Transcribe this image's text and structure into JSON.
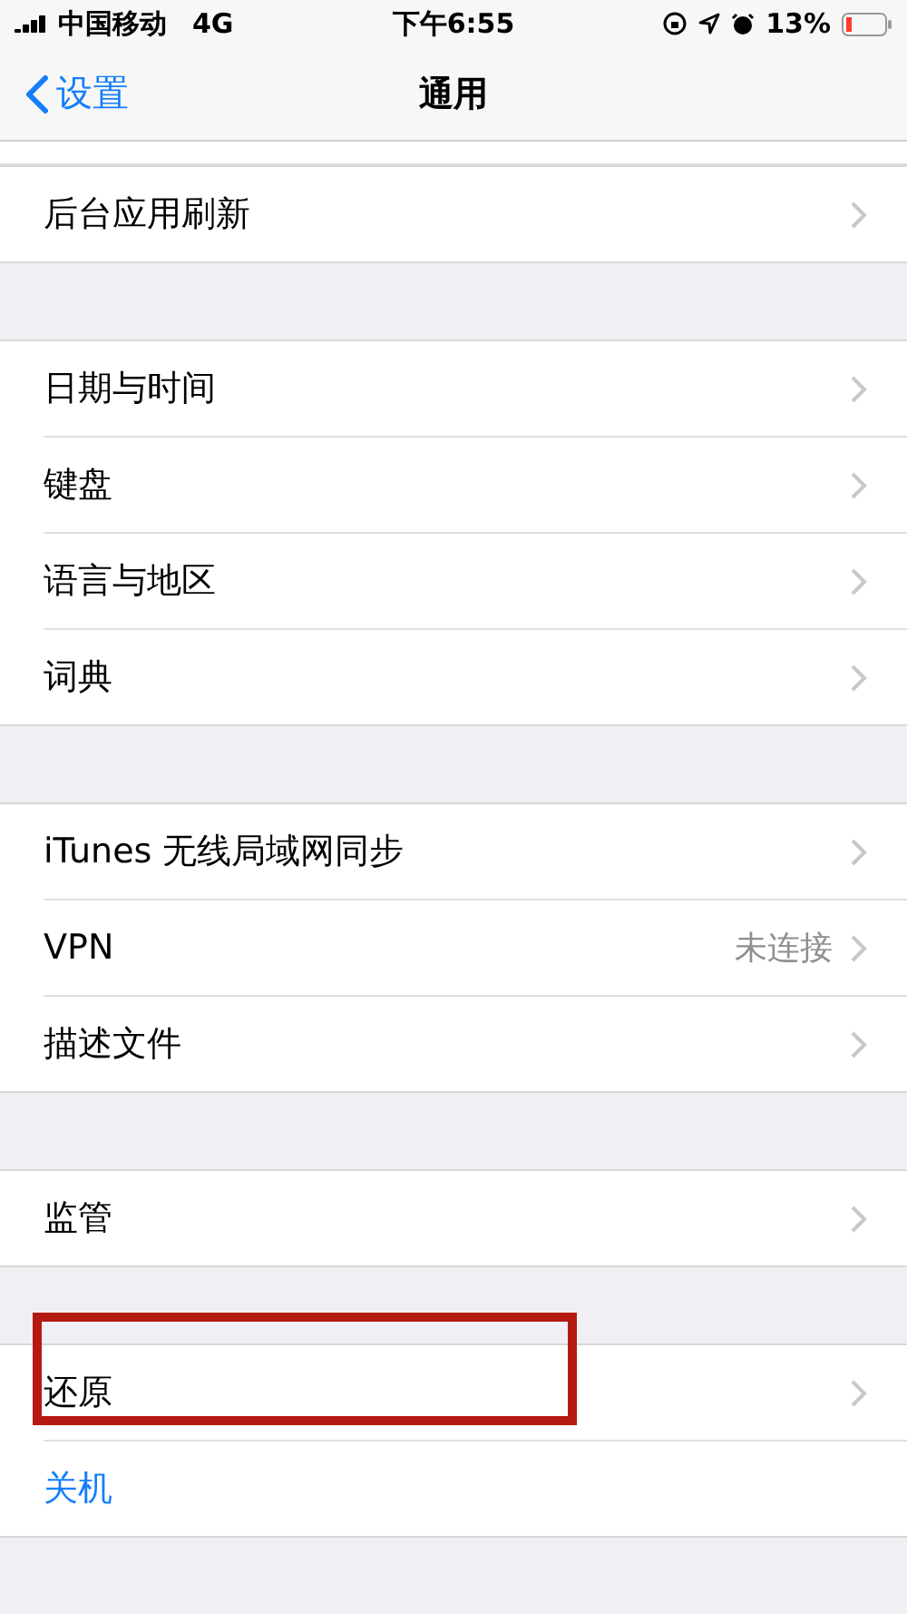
{
  "status_bar": {
    "carrier": "中国移动",
    "network": "4G",
    "time": "下午6:55",
    "battery": "13%"
  },
  "nav": {
    "back": "设置",
    "title": "通用"
  },
  "groups": [
    {
      "items": [
        {
          "label": "后台应用刷新",
          "kind": "nav",
          "highlighted": false
        }
      ]
    },
    {
      "items": [
        {
          "label": "日期与时间",
          "kind": "nav",
          "highlighted": false
        },
        {
          "label": "键盘",
          "kind": "nav",
          "highlighted": false
        },
        {
          "label": "语言与地区",
          "kind": "nav",
          "highlighted": false
        },
        {
          "label": "词典",
          "kind": "nav",
          "highlighted": false
        }
      ]
    },
    {
      "items": [
        {
          "label": "iTunes 无线局域网同步",
          "kind": "nav",
          "highlighted": false
        },
        {
          "label": "VPN",
          "value": "未连接",
          "kind": "nav",
          "highlighted": false
        },
        {
          "label": "描述文件",
          "kind": "nav",
          "highlighted": false
        }
      ]
    },
    {
      "items": [
        {
          "label": "监管",
          "kind": "nav",
          "highlighted": false
        }
      ]
    },
    {
      "items": [
        {
          "label": "还原",
          "kind": "nav",
          "highlighted": true
        },
        {
          "label": "关机",
          "kind": "action",
          "highlighted": false
        }
      ]
    }
  ]
}
